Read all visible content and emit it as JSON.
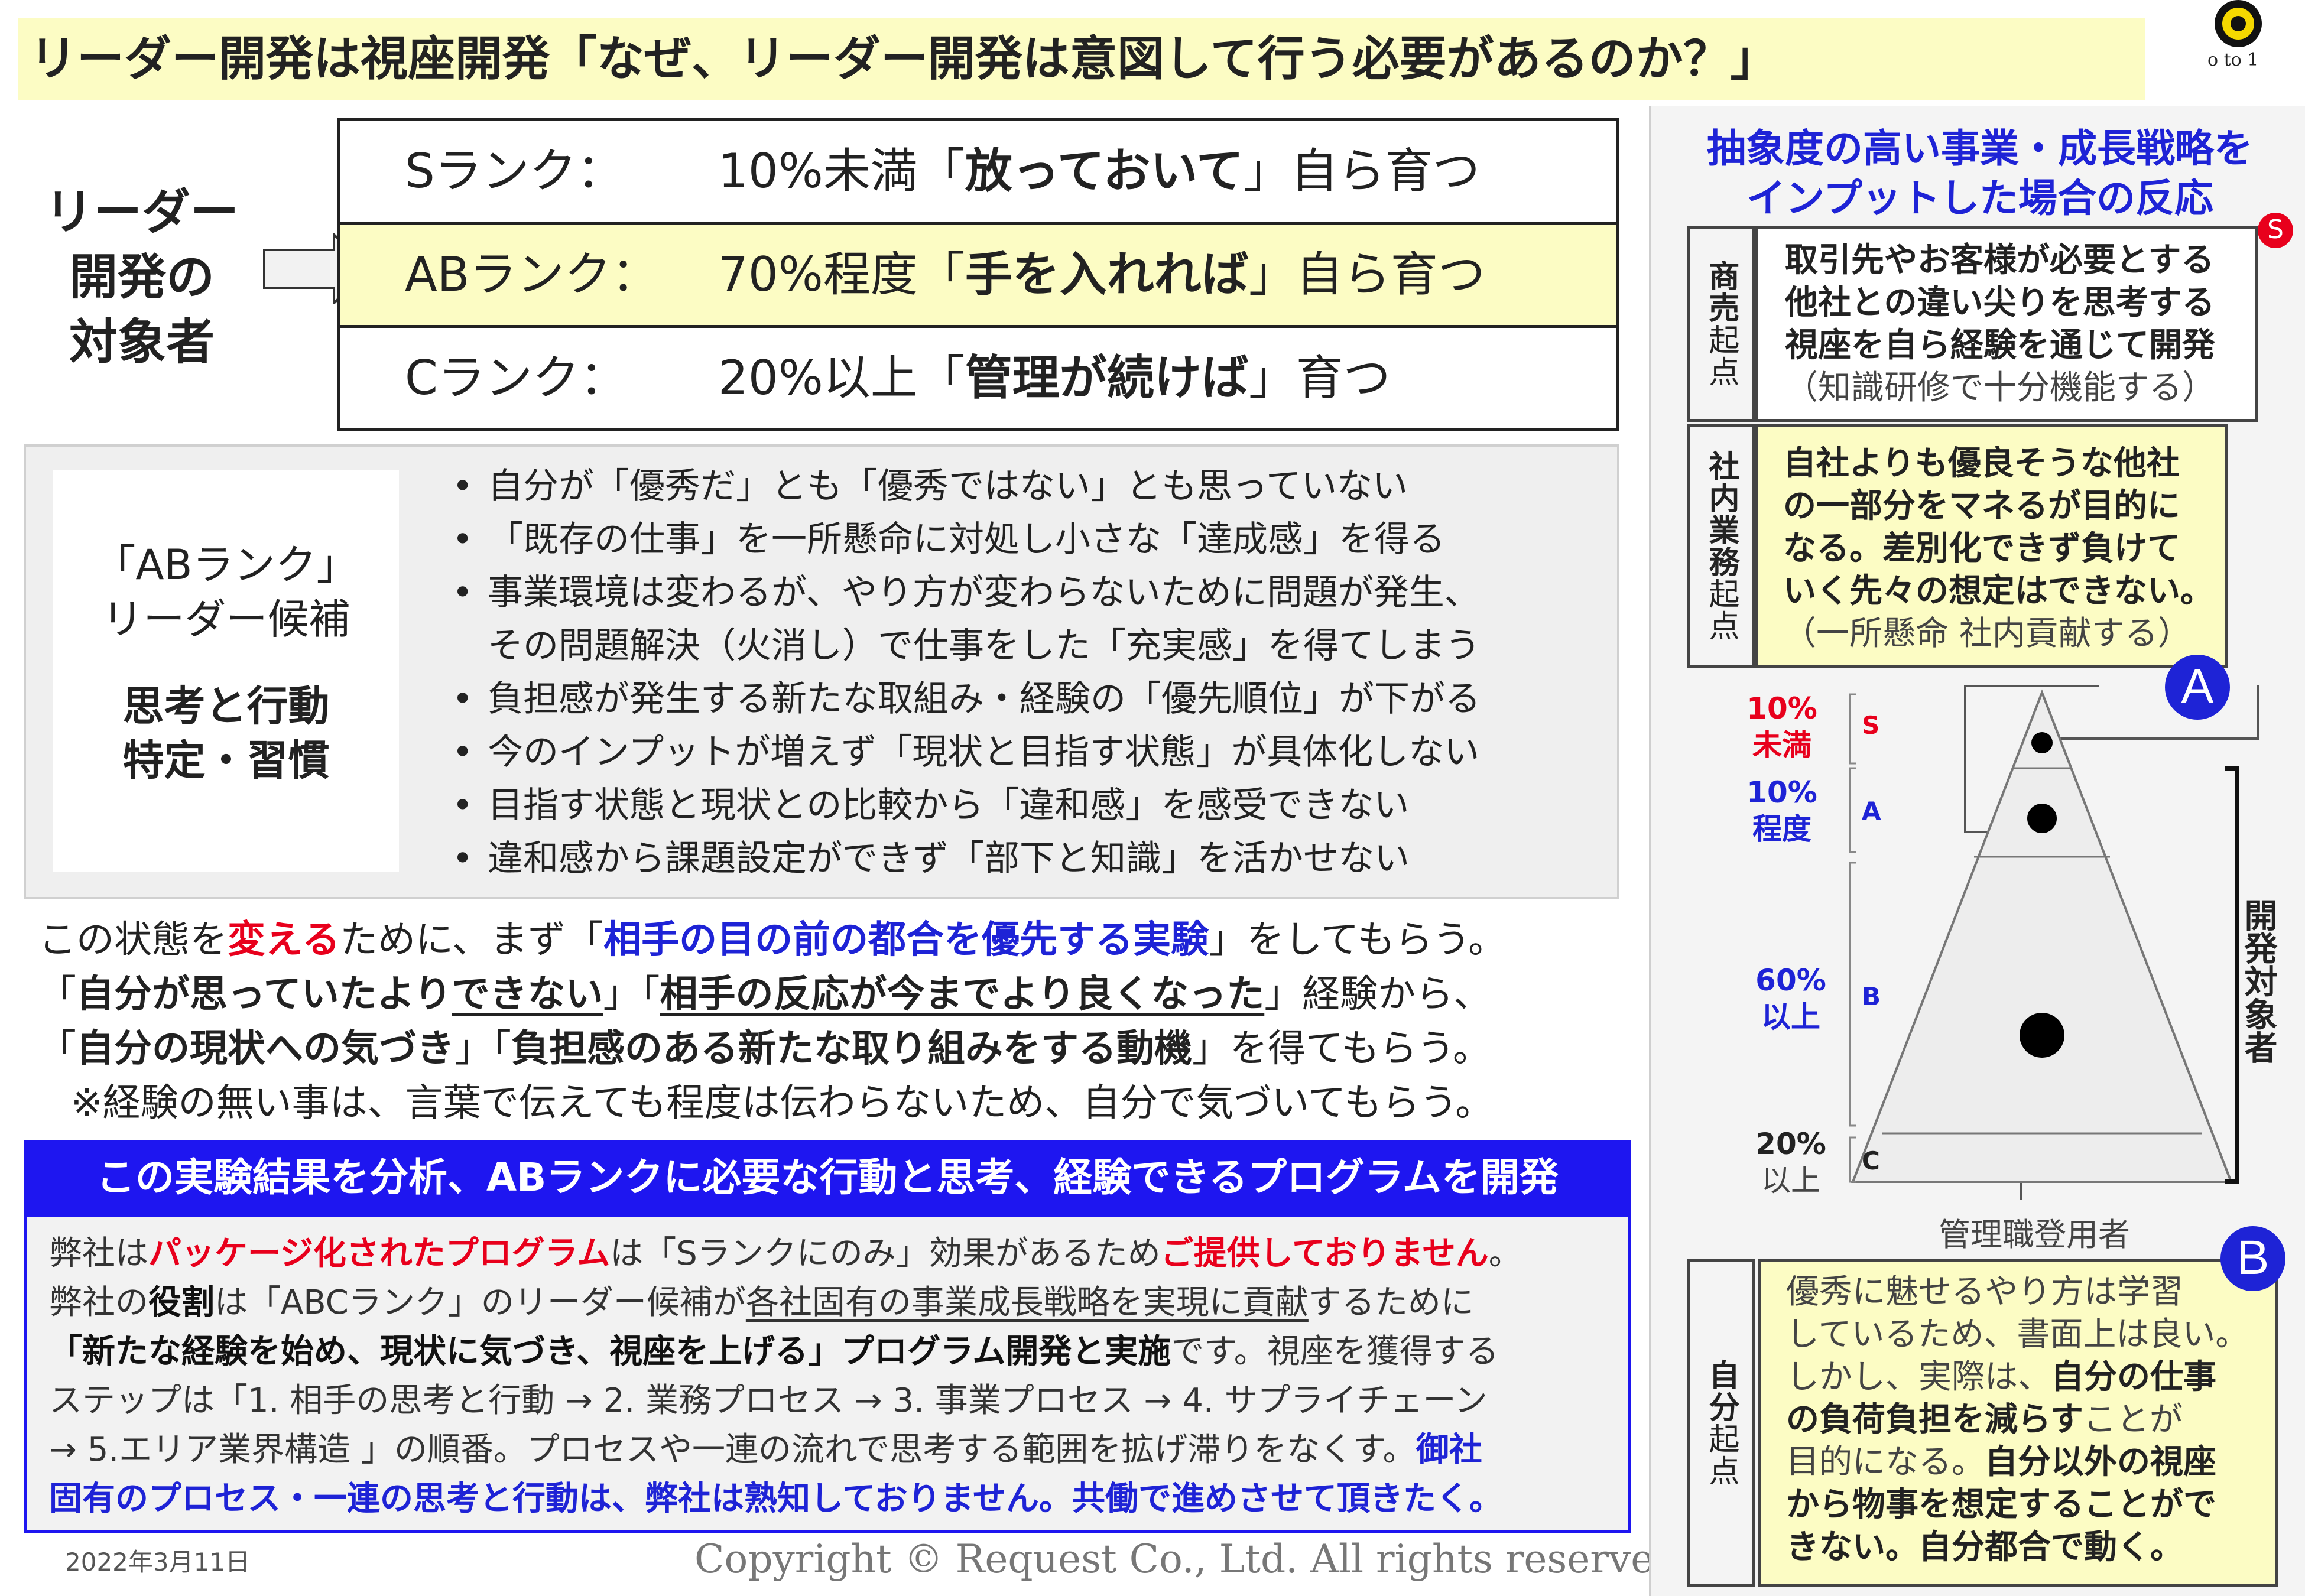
{
  "title": "リーダー開発は視座開発「なぜ、リーダー開発は意図して行う必要があるのか？」",
  "logo": {
    "text": "o to 1"
  },
  "target_label": [
    "リーダー",
    "開発の",
    "対象者"
  ],
  "ranks": [
    {
      "name": "Sランク：",
      "pre": "10%未満「",
      "bold": "放っておいて",
      "post": "」自ら育つ"
    },
    {
      "name": "ABランク：",
      "pre": "70%程度「",
      "bold": "手を入れれば",
      "post": "」自ら育つ"
    },
    {
      "name": "Cランク：",
      "pre": "20%以上「",
      "bold": "管理が続けば",
      "post": "」育つ"
    }
  ],
  "ab_label": {
    "line1": "「ABランク」",
    "line2": "リーダー候補",
    "line3": "思考と行動",
    "line4": "特定・習慣"
  },
  "bullets": [
    "自分が「優秀だ」とも「優秀ではない」とも思っていない",
    "「既存の仕事」を一所懸命に対処し小さな「達成感」を得る",
    "事業環境は変わるが、やり方が変わらないために問題が発生、",
    "その問題解決（火消し）で仕事をした「充実感」を得てしまう",
    "負担感が発生する新たな取組み・経験の「優先順位」が下がる",
    "今のインプットが増えず「現状と目指す状態」が具体化しない",
    "目指す状態と現状との比較から「違和感」を感受できない",
    "違和感から課題設定ができず「部下と知識」を活かせない"
  ],
  "para": {
    "l1a": "この状態を",
    "l1b": "変える",
    "l1c": "ために、まず「",
    "l1d": "相手の目の前の都合を優先する実験",
    "l1e": "」をしてもらう。",
    "l2a": "「",
    "l2b": "自分が思っていたより",
    "l2c": "できない",
    "l2d": "」「",
    "l2e": "相手の反応が今までより良くなった",
    "l2f": "」経験から、",
    "l3a": "「",
    "l3b": "自分の現状への気づき",
    "l3c": "」「",
    "l3d": "負担感のある新たな取り組みをする動機",
    "l3e": "」を得てもらう。",
    "l4": "※経験の無い事は、言葉で伝えても程度は伝わらないため、自分で気づいてもらう。"
  },
  "blue_heading": "この実験結果を分析、ABランクに必要な行動と思考、経験できるプログラムを開発",
  "blue_body": {
    "l1a": "弊社は",
    "l1b": "パッケージ化されたプログラム",
    "l1c": "は「Sランクにのみ」効果があるため",
    "l1d": "ご提供しておりません",
    "l1e": "。",
    "l2a": "弊社の",
    "l2b": "役割",
    "l2c": "は「ABCランク」のリーダー候補が",
    "l2d": "各社固有の事業成長戦略を実現に貢献",
    "l2e": "するために",
    "l3a": "「新たな経験を始め、現状に気づき、視座を上げる」プログラム開発と実施",
    "l3b": "です。視座を獲得する",
    "l4": "ステップは「1. 相手の思考と行動 → 2. 業務プロセス → 3. 事業プロセス → 4. サプライチェーン",
    "l5a": "→ 5.エリア業界構造 」の順番。プロセスや一連の流れで思考する範囲を拡げ滞りをなくす。",
    "l5b": "御社",
    "l6": "固有のプロセス・一連の思考と行動は、弊社は熟知しておりません。共働で進めさせて頂きたく。"
  },
  "date": "2022年3月11日",
  "copyright": "Copyright © Request Co., Ltd.  All rights reserved.",
  "right": {
    "title1": "抽象度の高い事業・成長戦略を",
    "title2": "インプットした場合の反応",
    "side_s": "商売起点",
    "side_s_bold": "商売",
    "side_s_rest": "起点",
    "side_a_bold": "社内業務",
    "side_a_rest": "起点",
    "side_b_bold": "自分",
    "side_b_rest": "起点",
    "badge_s": "S",
    "badge_a": "A",
    "badge_b": "B",
    "box_s": [
      "取引先やお客様が必要とする",
      "他社との違い尖りを思考する",
      "視座を自ら経験を通じて開発",
      "（知識研修で十分機能する）"
    ],
    "box_a": [
      "自社よりも優良そうな他社",
      "の一部分をマネるが目的に",
      "なる。差別化できず負けて",
      "いく先々の想定はできない。",
      "（一所懸命 社内貢献する）"
    ],
    "box_b": {
      "l1": "優秀に魅せるやり方は学習",
      "l2": "しているため、書面上は良い。",
      "l3a": "しかし、実際は、",
      "l3b": "自分の仕事",
      "l4a": "の負荷負担を減らす",
      "l4b": "ことが",
      "l5a": "目的になる。",
      "l5b": "自分以外の視座",
      "l6": "から物事を想定することがで",
      "l7": "きない。自分都合で動く。"
    },
    "pyramid": {
      "s_pct": "10%",
      "s_sub": "未満",
      "s_letter": "S",
      "a_pct": "10%",
      "a_sub": "程度",
      "a_letter": "A",
      "b_pct": "60%",
      "b_sub": "以上",
      "b_letter": "B",
      "c_pct": "20%",
      "c_sub": "以上",
      "c_letter": "C"
    },
    "manager_label": "管理職登用者",
    "dev_target": "開発対象者"
  },
  "colors": {
    "yellow": "#fcfcc4",
    "blue": "#1e16f0",
    "red": "#e8001c",
    "badge_blue": "#1e23d6"
  }
}
